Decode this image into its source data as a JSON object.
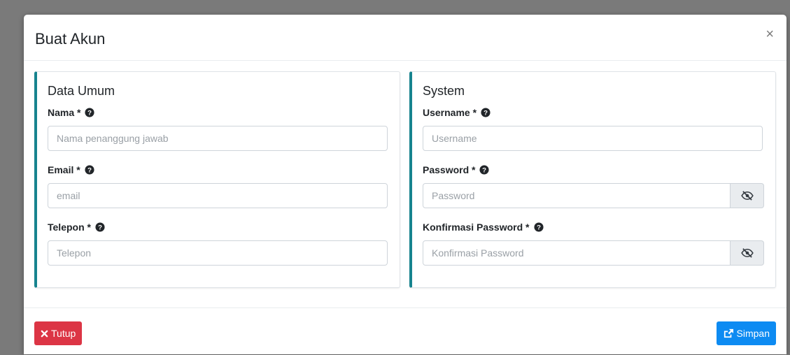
{
  "modal": {
    "title": "Buat Akun",
    "close_symbol": "×"
  },
  "general": {
    "title": "Data Umum",
    "fields": [
      {
        "label": "Nama *",
        "placeholder": "Nama penanggung jawab",
        "value": ""
      },
      {
        "label": "Email *",
        "placeholder": "email",
        "value": ""
      },
      {
        "label": "Telepon *",
        "placeholder": "Telepon",
        "value": ""
      }
    ]
  },
  "system": {
    "title": "System",
    "fields": [
      {
        "label": "Username *",
        "placeholder": "Username",
        "value": ""
      },
      {
        "label": "Password *",
        "placeholder": "Password",
        "value": ""
      },
      {
        "label": "Konfirmasi Password *",
        "placeholder": "Konfirmasi Password",
        "value": ""
      }
    ]
  },
  "footer": {
    "close_label": "Tutup",
    "save_label": "Simpan"
  },
  "colors": {
    "accent_border": "#17848f",
    "danger": "#dc3545",
    "primary": "#0d8bf2"
  },
  "icons": {
    "help": "question-circle-icon",
    "eye": "eye-slash-icon",
    "close": "times-icon",
    "save": "share-square-icon"
  }
}
